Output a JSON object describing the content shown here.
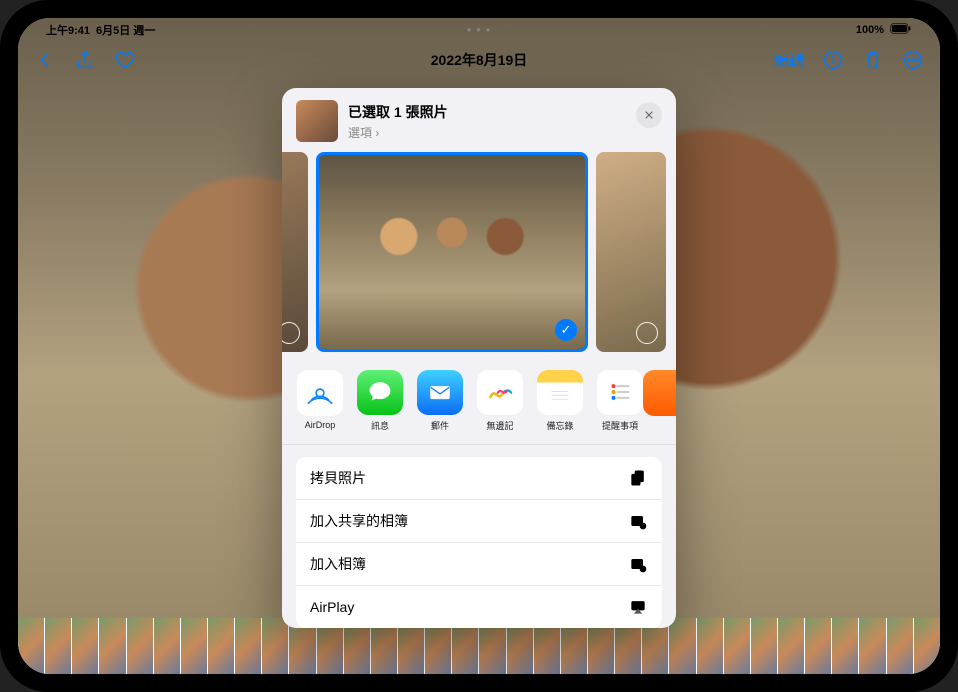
{
  "status": {
    "time": "上午9:41",
    "date": "6月5日 週一",
    "battery": "100%"
  },
  "nav": {
    "title": "2022年8月19日",
    "edit": "編輯"
  },
  "sheet": {
    "title": "已選取 1 張照片",
    "options": "選項 ›"
  },
  "apps": {
    "airdrop": "AirDrop",
    "messages": "訊息",
    "mail": "郵件",
    "freeform": "無邊記",
    "notes": "備忘錄",
    "reminders": "提醒事項"
  },
  "actions": {
    "copy": "拷貝照片",
    "shared_album": "加入共享的相簿",
    "album": "加入相簿",
    "airplay": "AirPlay"
  }
}
